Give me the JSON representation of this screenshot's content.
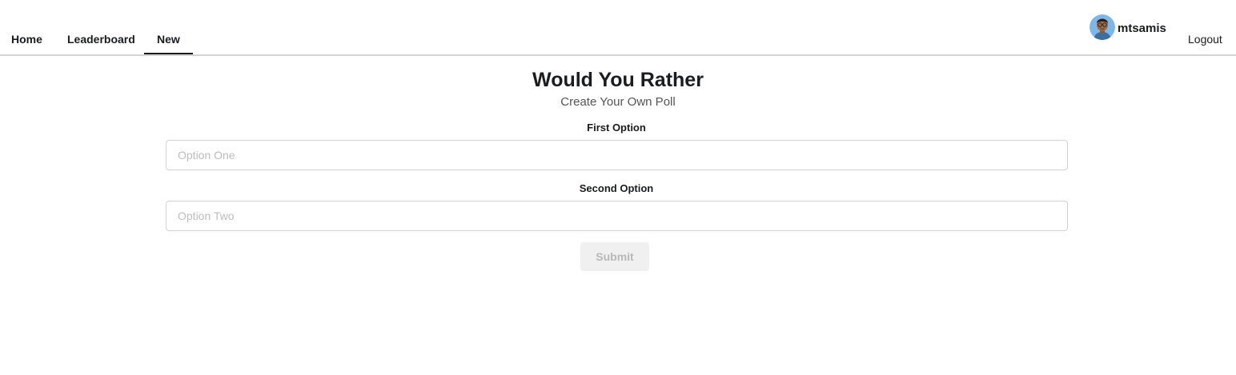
{
  "nav": {
    "items": [
      {
        "label": "Home"
      },
      {
        "label": "Leaderboard"
      },
      {
        "label": "New",
        "active": true
      }
    ],
    "user": {
      "username": "mtsamis",
      "avatar_icon": "user-avatar-icon"
    },
    "logout_label": "Logout"
  },
  "page": {
    "title": "Would You Rather",
    "subtitle": "Create Your Own Poll"
  },
  "form": {
    "option_one": {
      "label": "First Option",
      "placeholder": "Option One",
      "value": ""
    },
    "option_two": {
      "label": "Second Option",
      "placeholder": "Option Two",
      "value": ""
    },
    "submit_label": "Submit",
    "submit_disabled": true
  },
  "colors": {
    "text": "#1b1c1d",
    "border": "#d4d4d5",
    "placeholder": "#bdbdbd",
    "disabled_button_bg": "#f0f0f0",
    "disabled_button_text": "#b8b8b8",
    "avatar_bg": "#7cb7ea"
  }
}
